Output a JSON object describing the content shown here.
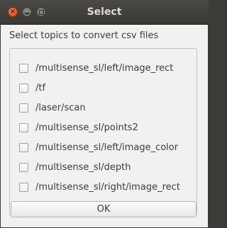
{
  "window": {
    "title": "Select",
    "close_glyph": "×",
    "controls": [
      "close-icon",
      "minimize-icon",
      "maximize-icon"
    ]
  },
  "dialog": {
    "prompt": "Select topics to convert csv files",
    "topics": [
      {
        "label": "/multisense_sl/left/image_rect",
        "checked": false
      },
      {
        "label": "/tf",
        "checked": false
      },
      {
        "label": "/laser/scan",
        "checked": false
      },
      {
        "label": "/multisense_sl/points2",
        "checked": false
      },
      {
        "label": "/multisense_sl/left/image_color",
        "checked": false
      },
      {
        "label": "/multisense_sl/depth",
        "checked": false
      },
      {
        "label": "/multisense_sl/right/image_rect",
        "checked": false
      }
    ],
    "ok_label": "OK"
  },
  "colors": {
    "titlebar": "#3c3b37",
    "close_button": "#e05a2d",
    "dialog_background": "#f2f1f0",
    "text": "#3c3c3c"
  }
}
